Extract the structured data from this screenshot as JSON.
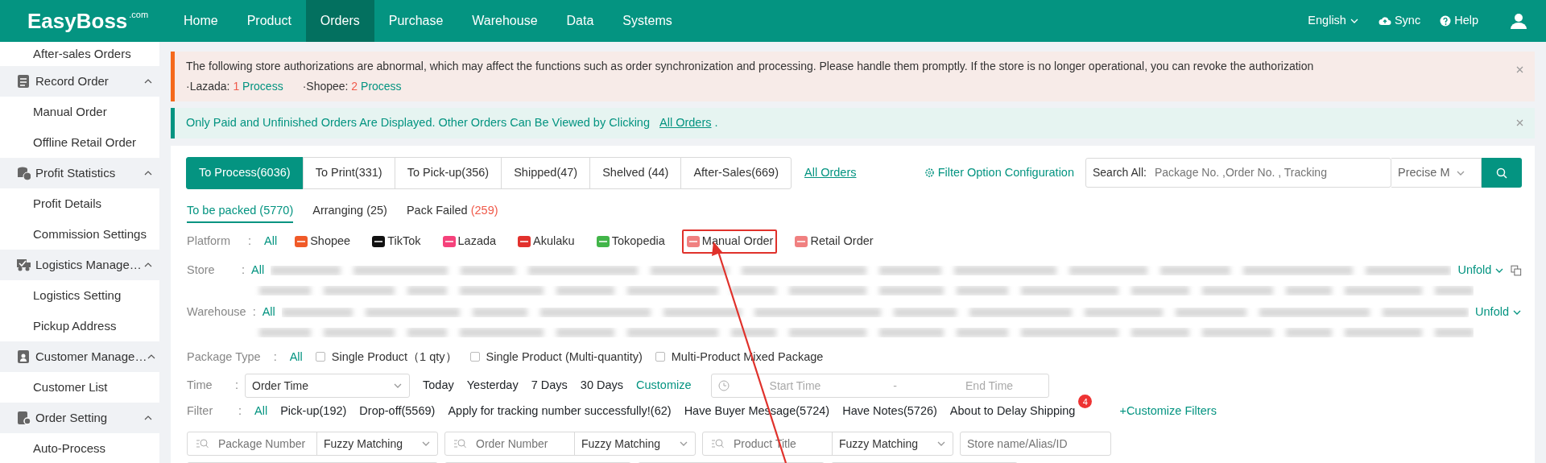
{
  "header": {
    "logo": "EasyBoss",
    "logo_suffix": ".com",
    "nav": [
      {
        "label": "Home",
        "selected": false
      },
      {
        "label": "Product",
        "selected": false
      },
      {
        "label": "Orders",
        "selected": true
      },
      {
        "label": "Purchase",
        "selected": false
      },
      {
        "label": "Warehouse",
        "selected": false
      },
      {
        "label": "Data",
        "selected": false
      },
      {
        "label": "Systems",
        "selected": false
      }
    ],
    "language": "English",
    "sync": "Sync",
    "help": "Help"
  },
  "sidebar": {
    "items": [
      {
        "label": "After-sales Orders",
        "kind": "item"
      },
      {
        "label": "Record Order",
        "kind": "group",
        "expanded": true,
        "children": [
          {
            "label": "Manual Order"
          },
          {
            "label": "Offline Retail Order"
          }
        ]
      },
      {
        "label": "Profit Statistics",
        "kind": "group",
        "expanded": true,
        "children": [
          {
            "label": "Profit Details"
          },
          {
            "label": "Commission Settings"
          }
        ]
      },
      {
        "label": "Logistics Manage…",
        "kind": "group",
        "expanded": true,
        "children": [
          {
            "label": "Logistics Setting"
          },
          {
            "label": "Pickup Address"
          }
        ]
      },
      {
        "label": "Customer Manage…",
        "kind": "group",
        "expanded": true,
        "children": [
          {
            "label": "Customer List"
          }
        ]
      },
      {
        "label": "Order Setting",
        "kind": "group",
        "expanded": true,
        "children": [
          {
            "label": "Auto-Process"
          }
        ]
      }
    ]
  },
  "alerts": [
    {
      "kind": "warning",
      "text": "The following store authorizations are abnormal, which may affect the functions such as order synchronization and processing. Please handle them promptly. If the store is no longer operational, you can revoke the authorization",
      "stores": [
        {
          "name": "·Lazada:",
          "count": "1",
          "action": "Process"
        },
        {
          "name": "·Shopee:",
          "count": "2",
          "action": "Process"
        }
      ]
    },
    {
      "kind": "info",
      "text": "Only Paid and Unfinished Orders Are Displayed. Other Orders Can Be Viewed by Clicking",
      "link": "All Orders",
      "tail": "."
    }
  ],
  "tabs": [
    {
      "label": "To Process(6036)",
      "selected": true
    },
    {
      "label": "To Print(331)",
      "selected": false
    },
    {
      "label": "To Pick-up(356)",
      "selected": false
    },
    {
      "label": "Shipped(47)",
      "selected": false
    },
    {
      "label": "Shelved (44)",
      "selected": false
    },
    {
      "label": "After-Sales(669)",
      "selected": false
    }
  ],
  "all_orders_link": "All Orders",
  "filter_config": "Filter Option Configuration",
  "search": {
    "label": "Search All:",
    "placeholder": "Package No. ,Order No. , Tracking",
    "mode": "Precise M"
  },
  "subtabs": [
    {
      "label": "To be packed",
      "count": "(5770)",
      "selected": true,
      "alert": false
    },
    {
      "label": "Arranging",
      "count": "(25)",
      "selected": false,
      "alert": false
    },
    {
      "label": "Pack Failed",
      "count": "(259)",
      "selected": false,
      "alert": true
    }
  ],
  "platform": {
    "label": "Platform",
    "colon": ":",
    "all": "All",
    "items": [
      {
        "label": "Shopee",
        "color": "#f05a28",
        "highlighted": false
      },
      {
        "label": "TikTok",
        "color": "#111111",
        "highlighted": false
      },
      {
        "label": "Lazada",
        "color": "#f5427b",
        "highlighted": false
      },
      {
        "label": "Akulaku",
        "color": "#e2312d",
        "highlighted": false
      },
      {
        "label": "Tokopedia",
        "color": "#42b549",
        "highlighted": false
      },
      {
        "label": "Manual Order",
        "color": "#f08080",
        "highlighted": true
      },
      {
        "label": "Retail Order",
        "color": "#f08080",
        "highlighted": false
      }
    ]
  },
  "store": {
    "label": "Store",
    "colon": ":",
    "all": "All",
    "unfold": "Unfold"
  },
  "warehouse": {
    "label": "Warehouse",
    "colon": ":",
    "all": "All",
    "unfold": "Unfold"
  },
  "package_type": {
    "label": "Package Type",
    "colon": ":",
    "all": "All",
    "options": [
      {
        "label": "Single Product（1 qty）",
        "checked": false
      },
      {
        "label": "Single Product (Multi-quantity)",
        "checked": false
      },
      {
        "label": "Multi-Product Mixed Package",
        "checked": false
      }
    ]
  },
  "time": {
    "label": "Time",
    "colon": ":",
    "select": "Order Time",
    "quick": [
      "Today",
      "Yesterday",
      "7 Days",
      "30 Days"
    ],
    "customize": "Customize",
    "start": "Start Time",
    "sep": "-",
    "end": "End Time"
  },
  "filter": {
    "label": "Filter",
    "colon": ":",
    "all": "All",
    "items": [
      {
        "label": "Pick-up(192)"
      },
      {
        "label": "Drop-off(5569)"
      },
      {
        "label": "Apply for tracking number successfully!(62)"
      },
      {
        "label": "Have Buyer Message(5724)"
      },
      {
        "label": "Have Notes(5726)"
      },
      {
        "label": "About to Delay Shipping",
        "badge": "4"
      }
    ],
    "customize": "+Customize Filters"
  },
  "fields": [
    {
      "placeholder": "Package Number",
      "match": "Fuzzy Matching"
    },
    {
      "placeholder": "Order Number",
      "match": "Fuzzy Matching"
    },
    {
      "placeholder": "Product Title",
      "match": "Fuzzy Matching"
    },
    {
      "placeholder": "Store name/Alias/ID"
    }
  ]
}
